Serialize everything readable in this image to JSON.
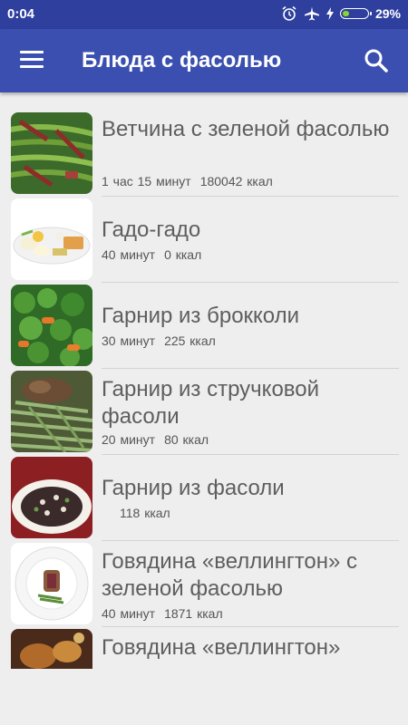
{
  "status": {
    "time": "0:04",
    "battery": "29%",
    "battery_level": 0.29
  },
  "appbar": {
    "title": "Блюда с фасолью",
    "menu_icon": "menu-icon",
    "search_icon": "search-icon"
  },
  "recipes": [
    {
      "name": "Ветчина с зеленой фасолью",
      "time": "1 час 15 минут",
      "kcal": "180042 ккал"
    },
    {
      "name": "Гадо-гадо",
      "time": "40 минут",
      "kcal": "0 ккал"
    },
    {
      "name": "Гарнир из брокколи",
      "time": "30 минут",
      "kcal": "225 ккал"
    },
    {
      "name": "Гарнир из стручковой фасоли",
      "time": "20 минут",
      "kcal": "80 ккал"
    },
    {
      "name": "Гарнир из фасоли",
      "time": "",
      "kcal": "118 ккал"
    },
    {
      "name": "Говядина «веллингтон» с зеленой фасолью",
      "time": "40 минут",
      "kcal": "1871 ккал"
    },
    {
      "name": "Говядина «веллингтон»",
      "time": "",
      "kcal": ""
    }
  ]
}
